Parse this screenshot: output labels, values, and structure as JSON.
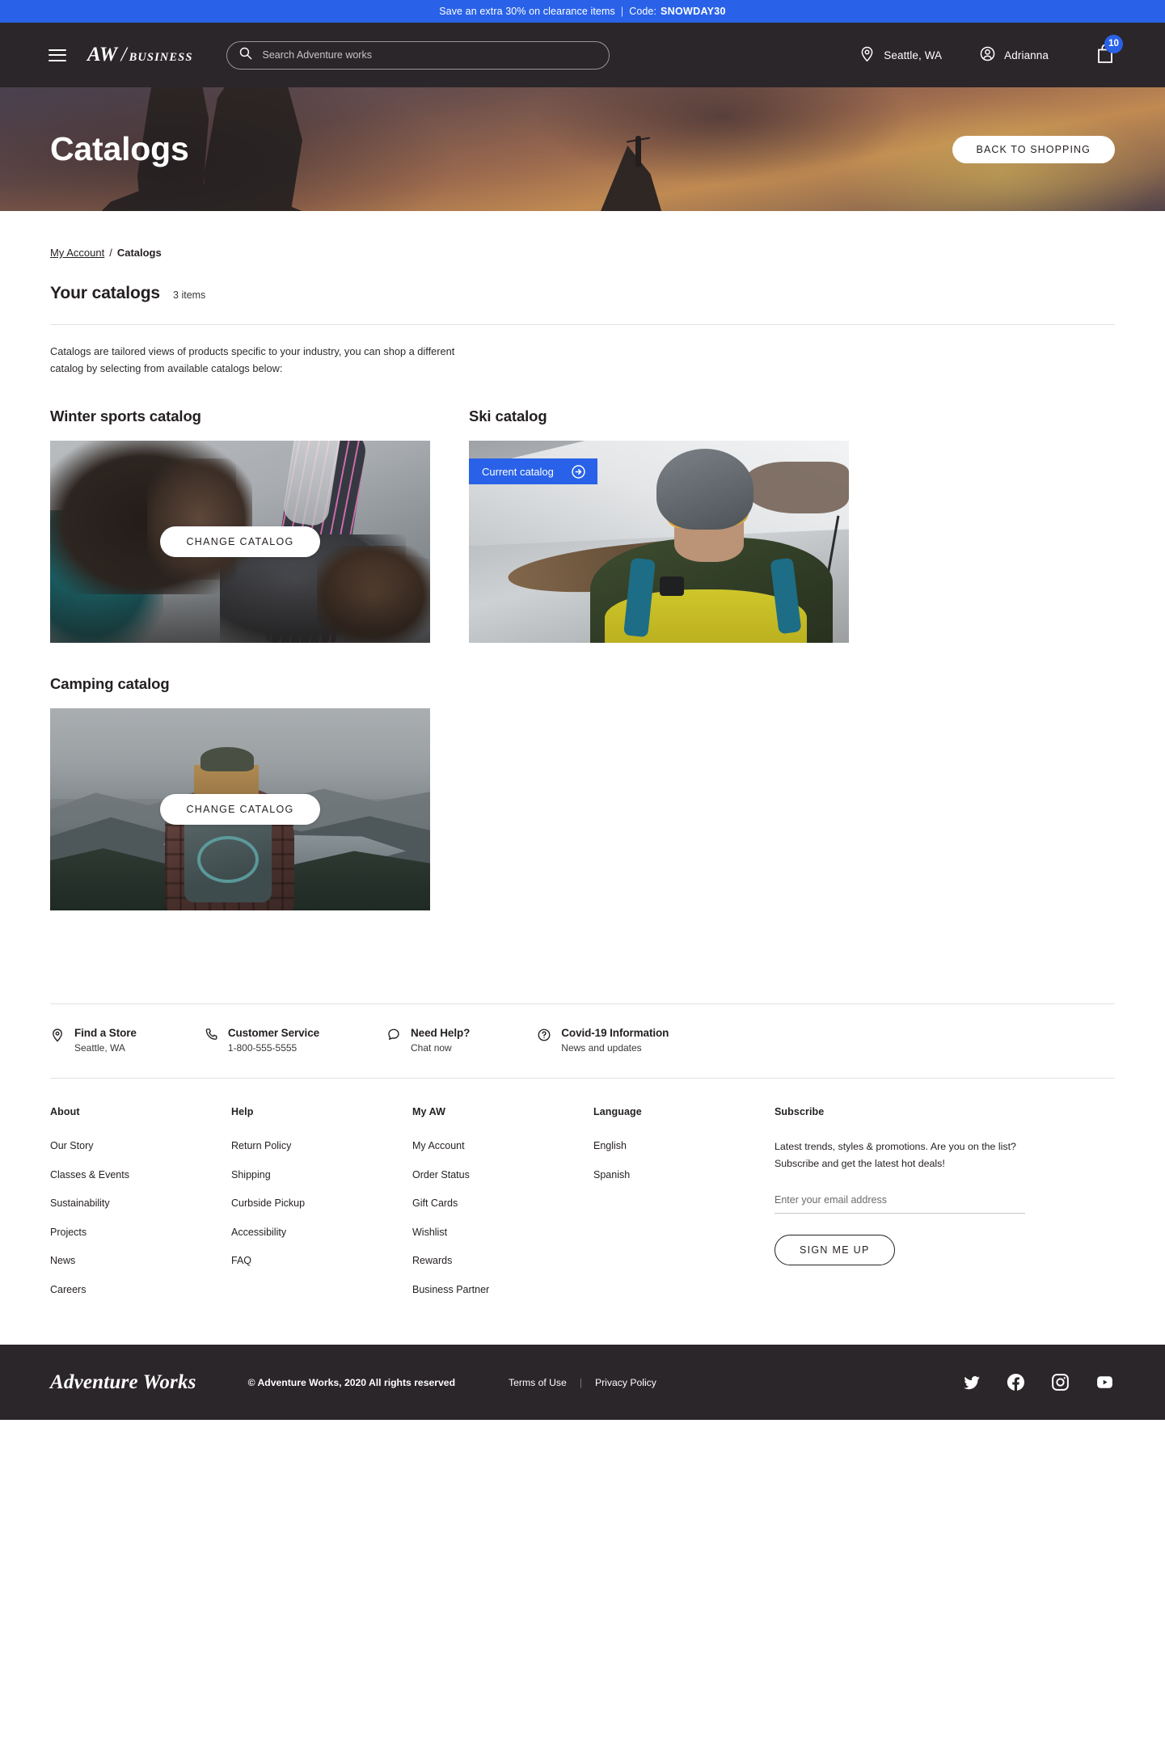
{
  "promo": {
    "message": "Save an extra 30% on clearance items",
    "separator": "|",
    "code_label": "Code:",
    "code": "SNOWDAY30",
    "bg_color": "#2962e8"
  },
  "header": {
    "menu_icon": "hamburger-icon",
    "logo_main": "AW",
    "logo_slash": "/",
    "logo_sub": "BUSINESS",
    "search": {
      "placeholder": "Search Adventure works",
      "value": "",
      "icon": "search-icon"
    },
    "location": {
      "label": "Seattle, WA",
      "icon": "location-pin-icon"
    },
    "account": {
      "label": "Adrianna",
      "icon": "user-circle-icon"
    },
    "cart": {
      "count": "10",
      "icon": "shopping-bag-icon"
    },
    "bg_color": "#2b2629"
  },
  "hero": {
    "title": "Catalogs",
    "back_button": "BACK TO SHOPPING"
  },
  "breadcrumb": {
    "parent": "My Account",
    "separator": "/",
    "current": "Catalogs"
  },
  "section": {
    "title": "Your catalogs",
    "count": "3 items",
    "description": "Catalogs are tailored views of products specific to your industry, you can shop a different catalog by selecting from available catalogs below:"
  },
  "catalogs": [
    {
      "title": "Winter sports catalog",
      "is_current": false,
      "button_label": "CHANGE CATALOG",
      "image_alt": "snowboarder-with-board"
    },
    {
      "title": "Ski catalog",
      "is_current": true,
      "badge_label": "Current catalog",
      "badge_icon": "arrow-right-circle-icon",
      "image_alt": "skier-in-helmet-and-goggles"
    },
    {
      "title": "Camping catalog",
      "is_current": false,
      "button_label": "CHANGE CATALOG",
      "image_alt": "hiker-with-backpack-overlooking-lake"
    }
  ],
  "services": [
    {
      "icon": "location-pin-icon",
      "title": "Find a Store",
      "sub": "Seattle, WA"
    },
    {
      "icon": "phone-icon",
      "title": "Customer Service",
      "sub": "1-800-555-5555"
    },
    {
      "icon": "chat-bubble-icon",
      "title": "Need Help?",
      "sub": "Chat now"
    },
    {
      "icon": "question-circle-icon",
      "title": "Covid-19 Information",
      "sub": "News and updates"
    }
  ],
  "footer_columns": [
    {
      "heading": "About",
      "links": [
        "Our Story",
        "Classes & Events",
        "Sustainability",
        "Projects",
        "News",
        "Careers"
      ]
    },
    {
      "heading": "Help",
      "links": [
        "Return Policy",
        "Shipping",
        "Curbside Pickup",
        "Accessibility",
        "FAQ"
      ]
    },
    {
      "heading": "My AW",
      "links": [
        "My Account",
        "Order Status",
        "Gift Cards",
        "Wishlist",
        "Rewards",
        "Business Partner"
      ]
    },
    {
      "heading": "Language",
      "links": [
        "English",
        "Spanish"
      ]
    }
  ],
  "subscribe": {
    "heading": "Subscribe",
    "line1": "Latest trends, styles & promotions. Are you on the list?",
    "line2": "Subscribe and get the latest hot deals!",
    "placeholder": "Enter your email address",
    "value": "",
    "button_label": "SIGN ME UP"
  },
  "bottom": {
    "logo": "Adventure Works",
    "copyright": "© Adventure Works, 2020 All rights reserved",
    "terms": "Terms of Use",
    "divider": "|",
    "privacy": "Privacy Policy",
    "social": [
      "twitter-icon",
      "facebook-icon",
      "instagram-icon",
      "youtube-icon"
    ]
  }
}
